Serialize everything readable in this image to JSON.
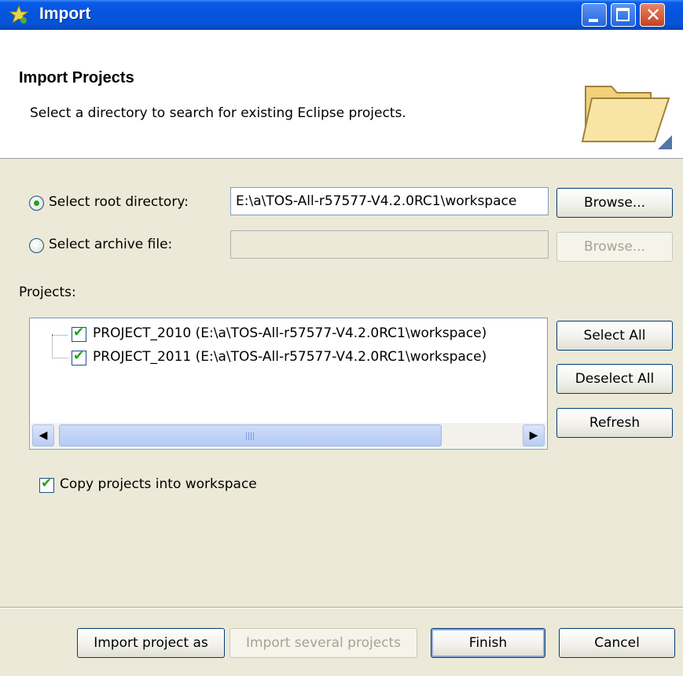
{
  "window": {
    "title": "Import",
    "controls": {
      "minimize": "minimize",
      "maximize": "maximize",
      "close": "✕"
    }
  },
  "header": {
    "heading": "Import Projects",
    "description": "Select a directory to search for existing Eclipse projects."
  },
  "source": {
    "root_radio_label": "Select root directory:",
    "root_value": "E:\\a\\TOS-All-r57577-V4.2.0RC1\\workspace",
    "browse_label": "Browse...",
    "archive_radio_label": "Select archive file:",
    "archive_value": "",
    "archive_browse_label": "Browse...",
    "selected": "root"
  },
  "projects": {
    "label": "Projects:",
    "items": [
      {
        "label": "PROJECT_2010 (E:\\a\\TOS-All-r57577-V4.2.0RC1\\workspace)",
        "checked": true
      },
      {
        "label": "PROJECT_2011 (E:\\a\\TOS-All-r57577-V4.2.0RC1\\workspace)",
        "checked": true
      }
    ],
    "select_all_label": "Select All",
    "deselect_all_label": "Deselect All",
    "refresh_label": "Refresh"
  },
  "options": {
    "copy_label": "Copy projects into workspace",
    "copy_checked": true
  },
  "footer": {
    "import_as_label": "Import project as",
    "import_several_label": "Import several projects",
    "finish_label": "Finish",
    "cancel_label": "Cancel"
  },
  "colors": {
    "titlebar": "#0554e0",
    "dialog_bg": "#ece9d8",
    "check_green": "#21a121"
  }
}
